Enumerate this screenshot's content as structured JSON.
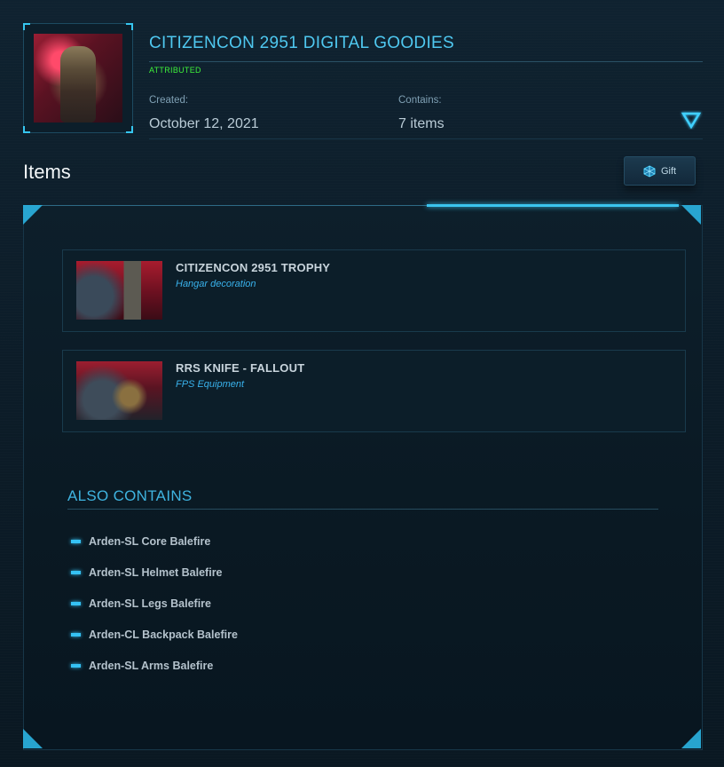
{
  "header": {
    "title": "CITIZENCON 2951 DIGITAL GOODIES",
    "status": "ATTRIBUTED",
    "created_label": "Created:",
    "created_value": "October 12, 2021",
    "contains_label": "Contains:",
    "contains_value": "7 items"
  },
  "items_section": {
    "heading": "Items",
    "gift_label": "Gift"
  },
  "items": [
    {
      "title": "CITIZENCON 2951 TROPHY",
      "subtitle": "Hangar decoration"
    },
    {
      "title": "RRS KNIFE - FALLOUT",
      "subtitle": "FPS Equipment"
    }
  ],
  "also_contains": {
    "heading": "ALSO CONTAINS",
    "items": [
      "Arden-SL Core Balefire",
      "Arden-SL Helmet Balefire",
      "Arden-SL Legs Balefire",
      "Arden-CL Backpack Balefire",
      "Arden-SL Arms Balefire"
    ]
  },
  "colors": {
    "accent": "#3bc4ee",
    "status": "#3ef03a",
    "background": "#0b1a25"
  },
  "icons": [
    "chevron-down-icon",
    "gift-icon"
  ]
}
